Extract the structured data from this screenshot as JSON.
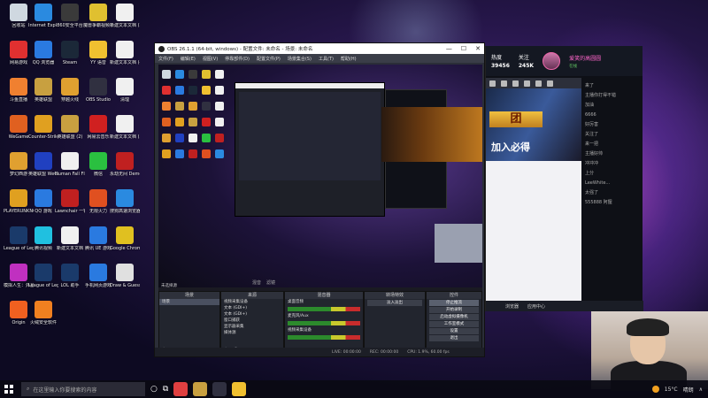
{
  "desktop": {
    "icons": [
      {
        "label": "回收站",
        "color": "#cfd8e0"
      },
      {
        "label": "Internet Explorer",
        "color": "#2a8ae0"
      },
      {
        "label": "360安全平台",
        "color": "#3a3a3a"
      },
      {
        "label": "魔兽争霸视频 无敌 3 11...",
        "color": "#e0c030"
      },
      {
        "label": "新建文本文档 (2)",
        "color": "#f0f0f0"
      },
      {
        "label": "网易游戏",
        "color": "#e03030"
      },
      {
        "label": "QQ 浏览器",
        "color": "#2a7ae0"
      },
      {
        "label": "Steam",
        "color": "#1b2838"
      },
      {
        "label": "YY 语音",
        "color": "#f0c030"
      },
      {
        "label": "新建文本文档 (4)",
        "color": "#f0f0f0"
      },
      {
        "label": "斗鱼直播",
        "color": "#f08030"
      },
      {
        "label": "英雄联盟",
        "color": "#c8a040"
      },
      {
        "label": "穿越火线",
        "color": "#e0a030"
      },
      {
        "label": "OBS Studio",
        "color": "#303040"
      },
      {
        "label": "清理",
        "color": "#f0f0f0"
      },
      {
        "label": "WeGame",
        "color": "#e06020"
      },
      {
        "label": "Counter-Strike Global Off...",
        "color": "#e0a020"
      },
      {
        "label": "英雄联盟 (2)",
        "color": "#c8a040"
      },
      {
        "label": "网易云音乐",
        "color": "#d02020"
      },
      {
        "label": "新建文本文档 (5)",
        "color": "#f0f0f0"
      },
      {
        "label": "梦幻西游",
        "color": "#e0a030"
      },
      {
        "label": "英雄联盟 WeGame版",
        "color": "#2040c0"
      },
      {
        "label": "Human Fall Flat",
        "color": "#f0f0f0"
      },
      {
        "label": "微信",
        "color": "#2ac040"
      },
      {
        "label": "永劫无间 Demo",
        "color": "#c02020"
      },
      {
        "label": "PLAYERUNKNOWN'S BATTLEGRO...",
        "color": "#e0a020"
      },
      {
        "label": "QQ 游戏",
        "color": "#2a7ae0"
      },
      {
        "label": "Lawnchair 一铁网游 (2)",
        "color": "#c02020"
      },
      {
        "label": "无限火力",
        "color": "#e05020"
      },
      {
        "label": "搜狗高速浏览器",
        "color": "#2a8ae0"
      },
      {
        "label": "League of Legends",
        "color": "#1a3a6a"
      },
      {
        "label": "腾讯视频",
        "color": "#20c0e0"
      },
      {
        "label": "新建文本文档",
        "color": "#f0f0f0"
      },
      {
        "label": "腾讯 UE 游戏",
        "color": "#2a7ae0"
      },
      {
        "label": "Google Chrome",
        "color": "#e0c020"
      },
      {
        "label": "模拟人生：外星 (2)",
        "color": "#c030c0"
      },
      {
        "label": "League of Legends (2)",
        "color": "#1a3a6a"
      },
      {
        "label": "LOL 助手",
        "color": "#1a3a6a"
      },
      {
        "label": "手机网页游戏",
        "color": "#2a7ae0"
      },
      {
        "label": "Draw & Guess",
        "color": "#e0e0e0"
      },
      {
        "label": "Origin",
        "color": "#f06020"
      },
      {
        "label": "火绒安全软件",
        "color": "#f08020"
      }
    ]
  },
  "obs": {
    "title": "OBS 26.1.1 (64-bit, windows) - 配置文件: 未命名 - 场景: 未命名",
    "controls": [
      "—",
      "☐",
      "✕"
    ],
    "menu": [
      "文件(F)",
      "编辑(E)",
      "视图(V)",
      "停靠部件(D)",
      "配置文件(P)",
      "场景集合(S)",
      "工具(T)",
      "帮助(H)"
    ],
    "preview_labels": [
      "混音",
      "滤镜"
    ],
    "no_source": "未选择源",
    "scenes_title": "场景",
    "scenes": [
      "场景"
    ],
    "sources_title": "来源",
    "sources": [
      "视频采集设备",
      "文本 (GDI+)",
      "文本 (GDI+)",
      "窗口捕获",
      "显示器采集",
      "媒体源"
    ],
    "mixer_title": "混音器",
    "mixer": [
      {
        "name": "桌面音频",
        "level": "0.0 dB"
      },
      {
        "name": "麦克风/Aux",
        "level": "0.0 dB"
      },
      {
        "name": "视频采集设备",
        "level": "0.0 dB"
      }
    ],
    "transition_title": "转场特效",
    "transition": "淡入淡出",
    "controls_title": "控件",
    "control_buttons": [
      "停止推流",
      "开始录制",
      "启动虚拟摄像机",
      "工作室模式",
      "设置",
      "退出"
    ],
    "status": [
      "LIVE: 00:00:00",
      "REC: 00:00:00",
      "CPU: 1.9%, 60.00 fps"
    ]
  },
  "live": {
    "stats": [
      {
        "label": "热度",
        "value": "39456"
      },
      {
        "label": "关注",
        "value": "245K"
      }
    ],
    "streamer": "爱笑的高圆圆",
    "online": "在线",
    "banner_gold": "团",
    "banner_text": "加入必得",
    "chat": [
      "来了",
      "主播你打得不错",
      "加油",
      "6666",
      "好厉害",
      "关注了",
      "来一把",
      "主播好帅",
      "冲冲冲",
      "上分",
      "LeeWhite...",
      "太强了",
      "555888 阿狸"
    ],
    "footer": [
      "浏览器",
      "应用中心"
    ]
  },
  "taskbar": {
    "search_placeholder": "在这里输入你要搜索的内容",
    "apps": [
      {
        "color": "#e04040"
      },
      {
        "color": "#c8a040"
      },
      {
        "color": "#303040"
      },
      {
        "color": "#f0c030"
      }
    ],
    "weather": "15°C",
    "weather_desc": "晴朗"
  }
}
